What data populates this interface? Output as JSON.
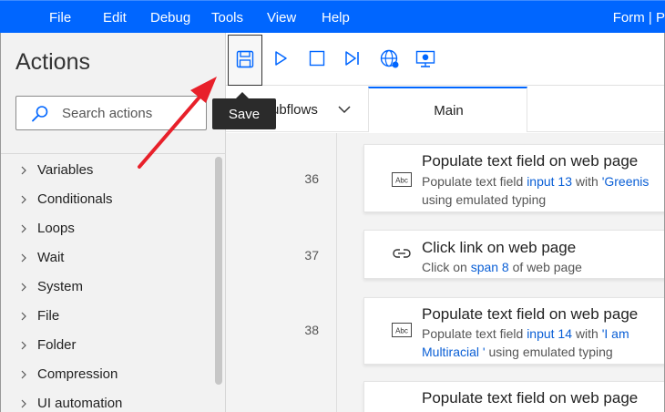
{
  "menubar": {
    "items": [
      "File",
      "Edit",
      "Debug",
      "Tools",
      "View",
      "Help"
    ],
    "right_text": "Form | P"
  },
  "actions_panel": {
    "title": "Actions",
    "search_placeholder": "Search actions",
    "categories": [
      "Variables",
      "Conditionals",
      "Loops",
      "Wait",
      "System",
      "File",
      "Folder",
      "Compression",
      "UI automation"
    ]
  },
  "toolbar": {
    "buttons": [
      "save-icon",
      "run-icon",
      "stop-icon",
      "next-step-icon",
      "web-recorder-icon",
      "desktop-recorder-icon"
    ],
    "tooltip": "Save"
  },
  "tabs": {
    "subflows": "ubflows",
    "main": "Main"
  },
  "flow": {
    "steps": [
      {
        "line": "36",
        "icon": "text-field-icon",
        "title": "Populate text field on web page",
        "desc_line1": [
          "Populate text field ",
          "input 13",
          " with ",
          "'Greenis"
        ],
        "desc_line2": "using emulated typing"
      },
      {
        "line": "37",
        "icon": "link-icon",
        "title": "Click link on web page",
        "desc_line1": [
          "Click on ",
          "span 8",
          " of web page"
        ]
      },
      {
        "line": "38",
        "icon": "text-field-icon",
        "title": "Populate text field on web page",
        "desc_line1": [
          "Populate text field ",
          "input 14",
          " with ",
          "'I am"
        ],
        "desc_line2": [
          "Multiracial '",
          " using emulated typing"
        ]
      },
      {
        "icon": "text-field-icon",
        "title": "Populate text field on web page"
      }
    ]
  },
  "colors": {
    "menubar": "#0066ff",
    "link": "#0a5fd6",
    "annotation_arrow": "#e8202a"
  }
}
